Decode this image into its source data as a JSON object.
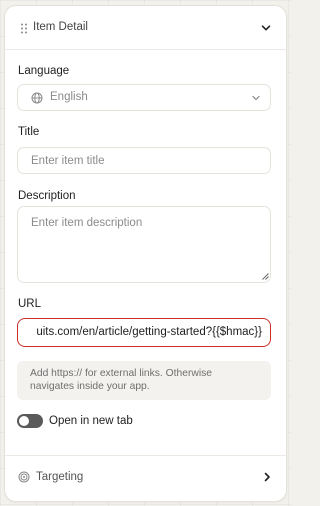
{
  "header": {
    "title": "Item Detail",
    "drag_icon": "drag-handle-icon",
    "collapse_icon": "chevron-down-icon"
  },
  "language": {
    "label": "Language",
    "value": "English",
    "icon": "globe-icon"
  },
  "title_field": {
    "label": "Title",
    "placeholder": "Enter item title",
    "value": ""
  },
  "description_field": {
    "label": "Description",
    "placeholder": "Enter item description",
    "value": ""
  },
  "url_field": {
    "label": "URL",
    "value": "uits.com/en/article/getting-started?{{$hmac}}",
    "error_color": "#cc2e26"
  },
  "hint": {
    "text": "Add https:// for external links. Otherwise navigates inside your app."
  },
  "open_new_tab": {
    "label": "Open in new tab",
    "checked": false
  },
  "targeting": {
    "label": "Targeting",
    "icon": "target-icon"
  }
}
